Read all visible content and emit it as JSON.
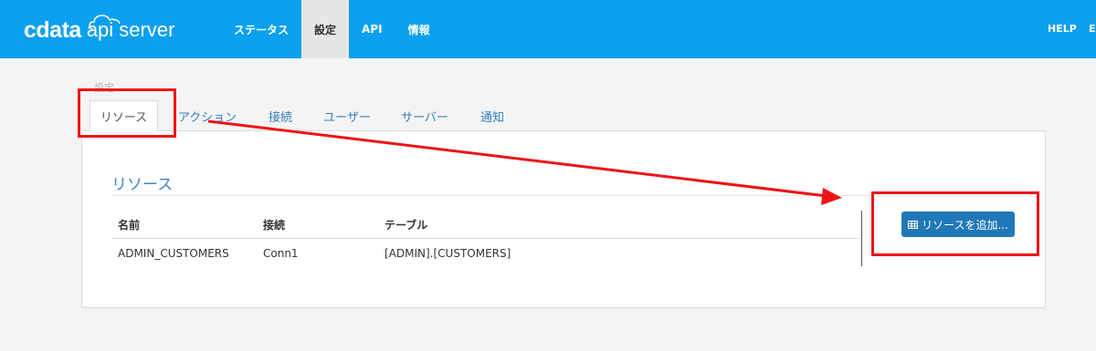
{
  "header": {
    "logo_main": "cdata",
    "logo_sub": "api server",
    "nav": [
      {
        "label": "ステータス",
        "active": false
      },
      {
        "label": "設定",
        "active": true
      },
      {
        "label": "API",
        "active": false
      },
      {
        "label": "情報",
        "active": false
      }
    ],
    "help_label": "HELP",
    "overflow_label": "E"
  },
  "breadcrumb": "設定",
  "tabs": [
    {
      "label": "リソース",
      "active": true
    },
    {
      "label": "アクション",
      "active": false
    },
    {
      "label": "接続",
      "active": false
    },
    {
      "label": "ユーザー",
      "active": false
    },
    {
      "label": "サーバー",
      "active": false
    },
    {
      "label": "通知",
      "active": false
    }
  ],
  "panel": {
    "title": "リソース",
    "columns": [
      "名前",
      "接続",
      "テーブル"
    ],
    "rows": [
      [
        "ADMIN_CUSTOMERS",
        "Conn1",
        "[ADMIN].[CUSTOMERS]"
      ]
    ],
    "add_button_label": "リソースを追加..."
  },
  "colors": {
    "header_bg": "#0aa0ef",
    "accent": "#3b86c6",
    "button": "#2178b8",
    "annotation": "#ec1515"
  }
}
